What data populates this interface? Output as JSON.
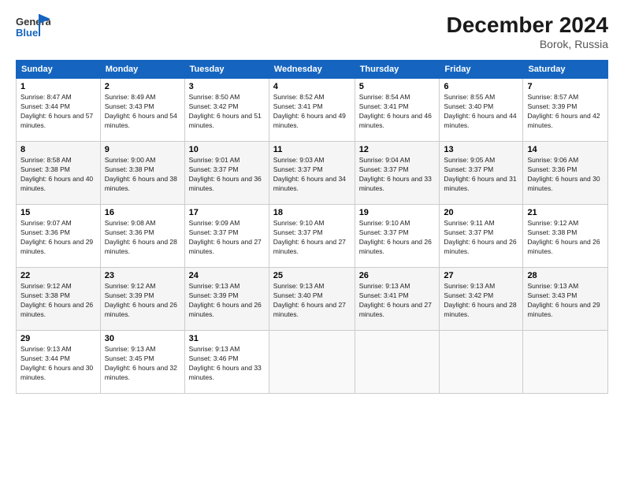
{
  "header": {
    "logo_general": "General",
    "logo_blue": "Blue",
    "title": "December 2024",
    "location": "Borok, Russia"
  },
  "weekdays": [
    "Sunday",
    "Monday",
    "Tuesday",
    "Wednesday",
    "Thursday",
    "Friday",
    "Saturday"
  ],
  "weeks": [
    [
      {
        "day": "1",
        "sunrise": "Sunrise: 8:47 AM",
        "sunset": "Sunset: 3:44 PM",
        "daylight": "Daylight: 6 hours and 57 minutes."
      },
      {
        "day": "2",
        "sunrise": "Sunrise: 8:49 AM",
        "sunset": "Sunset: 3:43 PM",
        "daylight": "Daylight: 6 hours and 54 minutes."
      },
      {
        "day": "3",
        "sunrise": "Sunrise: 8:50 AM",
        "sunset": "Sunset: 3:42 PM",
        "daylight": "Daylight: 6 hours and 51 minutes."
      },
      {
        "day": "4",
        "sunrise": "Sunrise: 8:52 AM",
        "sunset": "Sunset: 3:41 PM",
        "daylight": "Daylight: 6 hours and 49 minutes."
      },
      {
        "day": "5",
        "sunrise": "Sunrise: 8:54 AM",
        "sunset": "Sunset: 3:41 PM",
        "daylight": "Daylight: 6 hours and 46 minutes."
      },
      {
        "day": "6",
        "sunrise": "Sunrise: 8:55 AM",
        "sunset": "Sunset: 3:40 PM",
        "daylight": "Daylight: 6 hours and 44 minutes."
      },
      {
        "day": "7",
        "sunrise": "Sunrise: 8:57 AM",
        "sunset": "Sunset: 3:39 PM",
        "daylight": "Daylight: 6 hours and 42 minutes."
      }
    ],
    [
      {
        "day": "8",
        "sunrise": "Sunrise: 8:58 AM",
        "sunset": "Sunset: 3:38 PM",
        "daylight": "Daylight: 6 hours and 40 minutes."
      },
      {
        "day": "9",
        "sunrise": "Sunrise: 9:00 AM",
        "sunset": "Sunset: 3:38 PM",
        "daylight": "Daylight: 6 hours and 38 minutes."
      },
      {
        "day": "10",
        "sunrise": "Sunrise: 9:01 AM",
        "sunset": "Sunset: 3:37 PM",
        "daylight": "Daylight: 6 hours and 36 minutes."
      },
      {
        "day": "11",
        "sunrise": "Sunrise: 9:03 AM",
        "sunset": "Sunset: 3:37 PM",
        "daylight": "Daylight: 6 hours and 34 minutes."
      },
      {
        "day": "12",
        "sunrise": "Sunrise: 9:04 AM",
        "sunset": "Sunset: 3:37 PM",
        "daylight": "Daylight: 6 hours and 33 minutes."
      },
      {
        "day": "13",
        "sunrise": "Sunrise: 9:05 AM",
        "sunset": "Sunset: 3:37 PM",
        "daylight": "Daylight: 6 hours and 31 minutes."
      },
      {
        "day": "14",
        "sunrise": "Sunrise: 9:06 AM",
        "sunset": "Sunset: 3:36 PM",
        "daylight": "Daylight: 6 hours and 30 minutes."
      }
    ],
    [
      {
        "day": "15",
        "sunrise": "Sunrise: 9:07 AM",
        "sunset": "Sunset: 3:36 PM",
        "daylight": "Daylight: 6 hours and 29 minutes."
      },
      {
        "day": "16",
        "sunrise": "Sunrise: 9:08 AM",
        "sunset": "Sunset: 3:36 PM",
        "daylight": "Daylight: 6 hours and 28 minutes."
      },
      {
        "day": "17",
        "sunrise": "Sunrise: 9:09 AM",
        "sunset": "Sunset: 3:37 PM",
        "daylight": "Daylight: 6 hours and 27 minutes."
      },
      {
        "day": "18",
        "sunrise": "Sunrise: 9:10 AM",
        "sunset": "Sunset: 3:37 PM",
        "daylight": "Daylight: 6 hours and 27 minutes."
      },
      {
        "day": "19",
        "sunrise": "Sunrise: 9:10 AM",
        "sunset": "Sunset: 3:37 PM",
        "daylight": "Daylight: 6 hours and 26 minutes."
      },
      {
        "day": "20",
        "sunrise": "Sunrise: 9:11 AM",
        "sunset": "Sunset: 3:37 PM",
        "daylight": "Daylight: 6 hours and 26 minutes."
      },
      {
        "day": "21",
        "sunrise": "Sunrise: 9:12 AM",
        "sunset": "Sunset: 3:38 PM",
        "daylight": "Daylight: 6 hours and 26 minutes."
      }
    ],
    [
      {
        "day": "22",
        "sunrise": "Sunrise: 9:12 AM",
        "sunset": "Sunset: 3:38 PM",
        "daylight": "Daylight: 6 hours and 26 minutes."
      },
      {
        "day": "23",
        "sunrise": "Sunrise: 9:12 AM",
        "sunset": "Sunset: 3:39 PM",
        "daylight": "Daylight: 6 hours and 26 minutes."
      },
      {
        "day": "24",
        "sunrise": "Sunrise: 9:13 AM",
        "sunset": "Sunset: 3:39 PM",
        "daylight": "Daylight: 6 hours and 26 minutes."
      },
      {
        "day": "25",
        "sunrise": "Sunrise: 9:13 AM",
        "sunset": "Sunset: 3:40 PM",
        "daylight": "Daylight: 6 hours and 27 minutes."
      },
      {
        "day": "26",
        "sunrise": "Sunrise: 9:13 AM",
        "sunset": "Sunset: 3:41 PM",
        "daylight": "Daylight: 6 hours and 27 minutes."
      },
      {
        "day": "27",
        "sunrise": "Sunrise: 9:13 AM",
        "sunset": "Sunset: 3:42 PM",
        "daylight": "Daylight: 6 hours and 28 minutes."
      },
      {
        "day": "28",
        "sunrise": "Sunrise: 9:13 AM",
        "sunset": "Sunset: 3:43 PM",
        "daylight": "Daylight: 6 hours and 29 minutes."
      }
    ],
    [
      {
        "day": "29",
        "sunrise": "Sunrise: 9:13 AM",
        "sunset": "Sunset: 3:44 PM",
        "daylight": "Daylight: 6 hours and 30 minutes."
      },
      {
        "day": "30",
        "sunrise": "Sunrise: 9:13 AM",
        "sunset": "Sunset: 3:45 PM",
        "daylight": "Daylight: 6 hours and 32 minutes."
      },
      {
        "day": "31",
        "sunrise": "Sunrise: 9:13 AM",
        "sunset": "Sunset: 3:46 PM",
        "daylight": "Daylight: 6 hours and 33 minutes."
      },
      null,
      null,
      null,
      null
    ]
  ]
}
